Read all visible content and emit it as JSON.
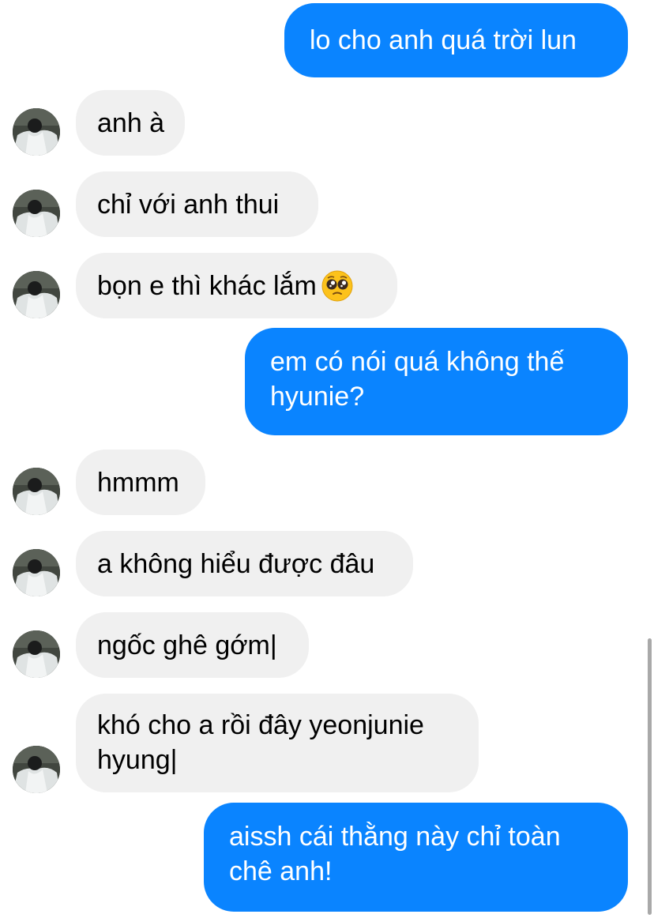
{
  "colors": {
    "outgoing_bubble": "#0a84ff",
    "incoming_bubble": "#f0f0f0",
    "outgoing_text": "#ffffff",
    "incoming_text": "#000000"
  },
  "messages": [
    {
      "direction": "outgoing",
      "text": "lo cho anh quá trời lun"
    },
    {
      "direction": "incoming",
      "text": "anh à"
    },
    {
      "direction": "incoming",
      "text": "chỉ với anh thui"
    },
    {
      "direction": "incoming",
      "text": "bọn e thì khác lắm",
      "emoji": "pleading-face-icon"
    },
    {
      "direction": "outgoing",
      "lines": [
        "em có nói quá không thế",
        "hyunie?"
      ]
    },
    {
      "direction": "incoming",
      "text": "hmmm"
    },
    {
      "direction": "incoming",
      "text": "a không hiểu được đâu"
    },
    {
      "direction": "incoming",
      "text": "ngốc ghê gớm|"
    },
    {
      "direction": "incoming",
      "lines": [
        "khó cho a rồi đây yeonjunie",
        "hyung|"
      ]
    },
    {
      "direction": "outgoing",
      "lines": [
        "aissh cái thằng này chỉ toàn",
        "chê anh!"
      ]
    }
  ]
}
